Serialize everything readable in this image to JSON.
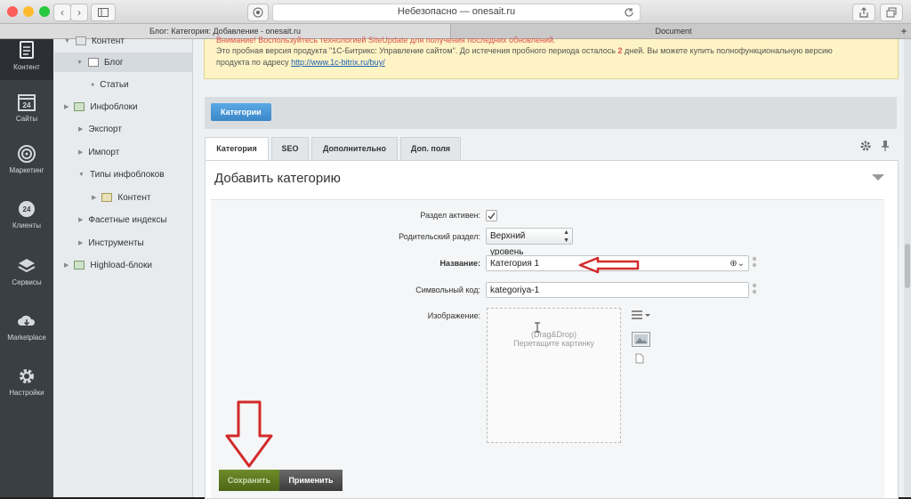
{
  "browser": {
    "url_text": "Небезопасно — onesait.ru",
    "tabs": [
      "Блог: Категория: Добавление - onesait.ru",
      "Document"
    ],
    "new_tab": "+"
  },
  "sidebar": {
    "items": [
      {
        "label": "Контент",
        "icon": "document-icon"
      },
      {
        "label": "Сайты",
        "icon": "calendar-24-icon"
      },
      {
        "label": "Маркетинг",
        "icon": "target-icon"
      },
      {
        "label": "Клиенты",
        "icon": "clients-24-icon"
      },
      {
        "label": "Сервисы",
        "icon": "layers-icon"
      },
      {
        "label": "Marketplace",
        "icon": "cloud-download-icon"
      },
      {
        "label": "Настройки",
        "icon": "gear-icon"
      }
    ]
  },
  "tree": {
    "items": [
      {
        "label": "Контент"
      },
      {
        "label": "Блог"
      },
      {
        "label": "Статьи"
      },
      {
        "label": "Инфоблоки"
      },
      {
        "label": "Экспорт"
      },
      {
        "label": "Импорт"
      },
      {
        "label": "Типы инфоблоков"
      },
      {
        "label": "Контент"
      },
      {
        "label": "Фасетные индексы"
      },
      {
        "label": "Инструменты"
      },
      {
        "label": "Highload-блоки"
      }
    ]
  },
  "notice": {
    "line1": "Внимание! Воспользуйтесь технологией SiteUpdate для получения последних обновлений.",
    "line2_a": "Это пробная версия продукта \"1С-Битрикс: Управление сайтом\". До истечения пробного периода осталось ",
    "line2_days": "2",
    "line2_b": " дней. Вы можете купить полнофункциональную версию",
    "line3_a": "продукта по адресу ",
    "line3_link": "http://www.1c-bitrix.ru/buy/"
  },
  "breadcrumb": {
    "label": "Категории"
  },
  "form_tabs": [
    "Категория",
    "SEO",
    "Дополнительно",
    "Доп. поля"
  ],
  "form": {
    "title": "Добавить категорию",
    "active_label": "Раздел активен:",
    "parent_label": "Родительский раздел:",
    "parent_value": "Верхний уровень",
    "name_label": "Название:",
    "name_value": "Категория 1",
    "code_label": "Символьный код:",
    "code_value": "kategoriya-1",
    "image_label": "Изображение:",
    "dnd_line1": "(Drag&Drop)",
    "dnd_line2": "Перетащите картинку"
  },
  "buttons": {
    "save": "Сохранить",
    "apply": "Применить"
  },
  "colors": {
    "annotation_red": "#d32a2a",
    "save_green": "#5c7a1e",
    "crumb_blue": "#3b87c8"
  }
}
